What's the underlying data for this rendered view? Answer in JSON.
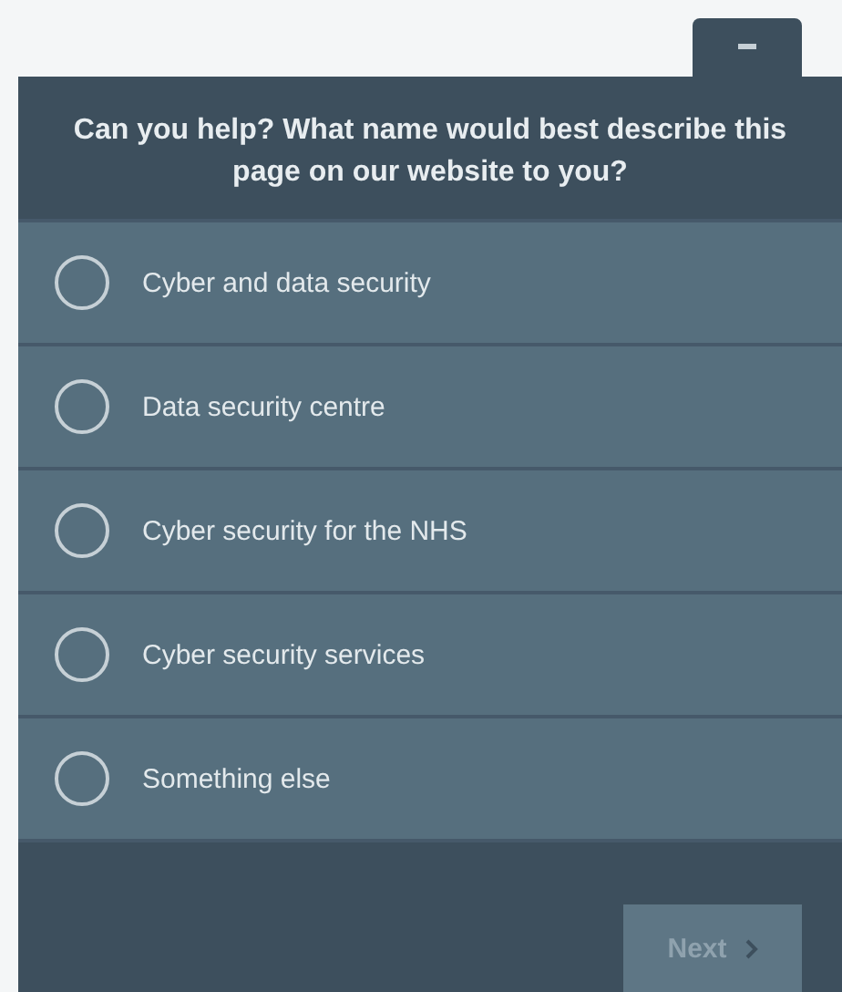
{
  "survey": {
    "question": "Can you help? What name would best describe this page on our website to you?",
    "options": [
      {
        "label": "Cyber and data security",
        "selected": false
      },
      {
        "label": "Data security centre",
        "selected": false
      },
      {
        "label": "Cyber security for the NHS",
        "selected": false
      },
      {
        "label": "Cyber security services",
        "selected": false
      },
      {
        "label": "Something else",
        "selected": false
      }
    ],
    "next_button": {
      "label": "Next",
      "disabled": true
    }
  }
}
